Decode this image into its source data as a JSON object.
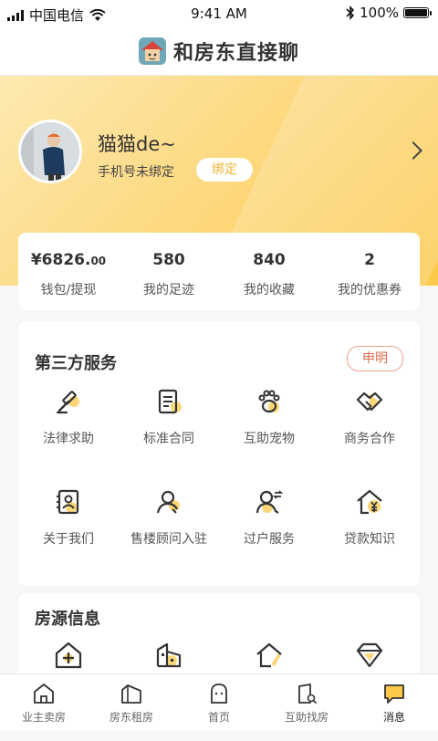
{
  "status": {
    "carrier": "中国电信",
    "time": "9:41 AM",
    "battery": "100%"
  },
  "app": {
    "title": "和房东直接聊"
  },
  "profile": {
    "name": "猫猫de~",
    "phone_status": "手机号未绑定",
    "bind_label": "绑定"
  },
  "stats": [
    {
      "value": "¥6826.",
      "decimal": "00",
      "label": "钱包/提现"
    },
    {
      "value": "580",
      "decimal": "",
      "label": "我的足迹"
    },
    {
      "value": "840",
      "decimal": "",
      "label": "我的收藏"
    },
    {
      "value": "2",
      "decimal": "",
      "label": "我的优惠券"
    }
  ],
  "services": {
    "title": "第三方服务",
    "declare_label": "申明",
    "items": [
      {
        "label": "法律求助",
        "icon": "gavel-icon"
      },
      {
        "label": "标准合同",
        "icon": "contract-icon"
      },
      {
        "label": "互助宠物",
        "icon": "paw-icon"
      },
      {
        "label": "商务合作",
        "icon": "handshake-icon"
      },
      {
        "label": "关于我们",
        "icon": "about-icon"
      },
      {
        "label": "售楼顾问入驻",
        "icon": "consultant-icon"
      },
      {
        "label": "过户服务",
        "icon": "transfer-icon"
      },
      {
        "label": "贷款知识",
        "icon": "loan-icon"
      }
    ]
  },
  "listings": {
    "title": "房源信息",
    "items": [
      {
        "icon": "house-add-icon"
      },
      {
        "icon": "building-icon"
      },
      {
        "icon": "house-edit-icon"
      },
      {
        "icon": "diamond-icon"
      }
    ]
  },
  "tabs": [
    {
      "label": "业主卖房",
      "icon": "house-icon"
    },
    {
      "label": "房东租房",
      "icon": "rent-house-icon"
    },
    {
      "label": "首页",
      "icon": "home-icon"
    },
    {
      "label": "互助找房",
      "icon": "search-house-icon"
    },
    {
      "label": "消息",
      "icon": "message-icon"
    }
  ],
  "colors": {
    "accent": "#fcc94a",
    "declare": "#e06c4a",
    "bind_text": "#f0b532"
  }
}
